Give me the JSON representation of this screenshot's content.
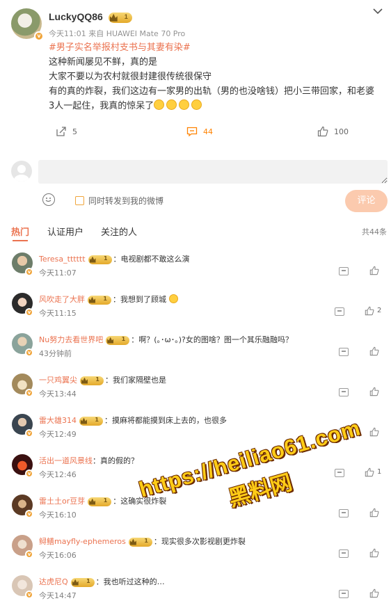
{
  "post": {
    "author": "LuckyQQ86",
    "level": "1",
    "meta": "今天11:01  来自 HUAWEI Mate 70 Pro",
    "topic": "#男子实名举报村支书与其妻有染#",
    "lines": [
      "这种新闻屡见不鲜，真的是",
      "大家不要以为农村就很封建很传统很保守",
      "有的真的炸裂，我们这边有一家男的出轨（男的也没啥钱）把小三带回家，和老婆3人一起住，我真的惊呆了"
    ],
    "emoji_icon": "laugh-cry-emoji"
  },
  "actions": {
    "repost_count": "5",
    "comment_count": "44",
    "like_count": "100"
  },
  "composer": {
    "placeholder": "",
    "forward_label": "同时转发到我的微博",
    "submit_label": "评论"
  },
  "tabs": [
    {
      "label": "热门"
    },
    {
      "label": "认证用户"
    },
    {
      "label": "关注的人"
    }
  ],
  "comment_total": "共44条",
  "comments": [
    {
      "name": "Teresa_tttttt",
      "text": "：电视剧都不敢这么演",
      "time": "今天11:07",
      "likes": ""
    },
    {
      "name": "风吹走了大胖",
      "text": "：我想到了顾城 ",
      "time": "今天11:15",
      "likes": "2"
    },
    {
      "name": "Nu努力去看世界吧",
      "text": "：啊？(｡･ω･｡)?女的图啥？图一个其乐融融吗？",
      "time": "43分钟前",
      "likes": ""
    },
    {
      "name": "一只鸡翼尖",
      "text": "：我们家隔壁也是",
      "time": "今天13:44",
      "likes": ""
    },
    {
      "name": "雷大雄314",
      "text": "：摸麻将都能摸到床上去的，也很多",
      "time": "今天12:49",
      "likes": ""
    },
    {
      "name": "活出一道风景线",
      "text": "：真的假的？",
      "time": "今天12:46",
      "likes": "1"
    },
    {
      "name": "雷土土or豆芽",
      "text": "：这确实很炸裂",
      "time": "今天16:10",
      "likes": ""
    },
    {
      "name": "鲟鳝mayfly-ephemeros",
      "text": "：现实很多次影视剧更炸裂",
      "time": "今天16:06",
      "likes": ""
    },
    {
      "name": "达虎尼Q",
      "text": "：我也听过这种的…",
      "time": "今天14:47",
      "likes": ""
    }
  ],
  "watermark": {
    "url": "https://heiliao61.com",
    "name": "黑料网"
  },
  "colors": {
    "accent": "#eb7350",
    "comment_accent": "#ff8200",
    "submit_bg": "#fbcaae"
  }
}
